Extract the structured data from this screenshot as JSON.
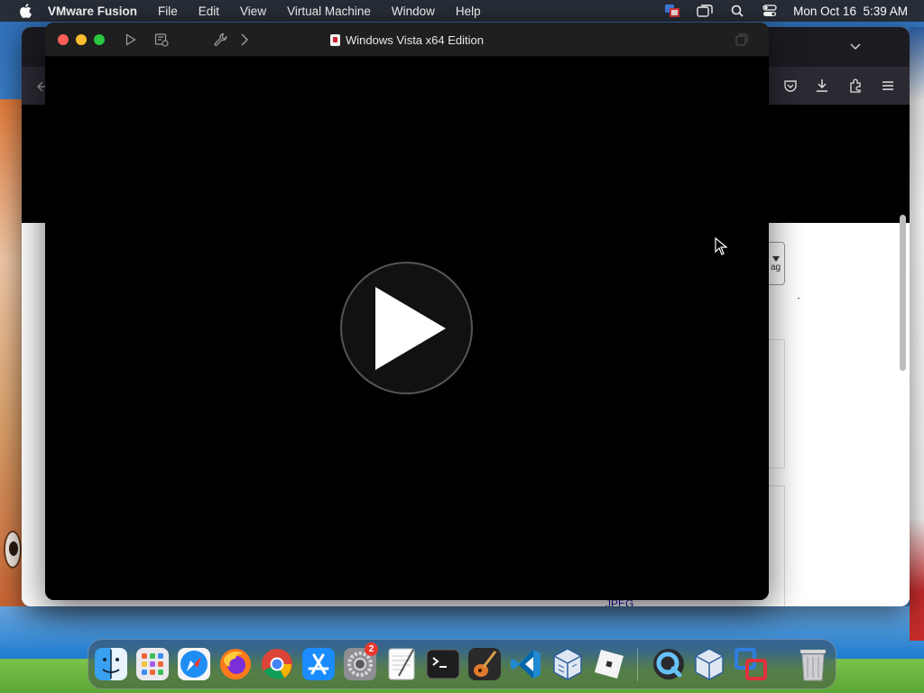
{
  "menubar": {
    "app_name": "VMware Fusion",
    "menus": [
      "File",
      "Edit",
      "View",
      "Virtual Machine",
      "Window",
      "Help"
    ],
    "status_icons": [
      "screen-share-icon",
      "window-mirror-icon",
      "search-icon",
      "control-center-icon"
    ],
    "datetime": "Mon Oct 16  5:39 AM"
  },
  "vm_window": {
    "title": "Windows Vista x64 Edition",
    "toolbar_icons": [
      "play-icon",
      "snapshot-icon",
      "settings-wrench-icon",
      "forward-chevron-icon"
    ],
    "screen_state": "powered-off",
    "play_button_icon": "play-triangle-icon"
  },
  "browser_window": {
    "toolbar_icons": [
      "back-arrow-icon",
      "pocket-icon",
      "download-icon",
      "extensions-icon",
      "menu-hamburger-icon"
    ],
    "flag_label": "ag",
    "link_text": "JPEG"
  },
  "dock": {
    "apps": [
      {
        "name": "Finder",
        "icon": "finder-icon"
      },
      {
        "name": "Launchpad",
        "icon": "launchpad-icon"
      },
      {
        "name": "Safari",
        "icon": "safari-icon"
      },
      {
        "name": "Firefox",
        "icon": "firefox-icon"
      },
      {
        "name": "Google Chrome",
        "icon": "chrome-icon"
      },
      {
        "name": "App Store",
        "icon": "app-store-icon"
      },
      {
        "name": "System Settings",
        "icon": "system-settings-icon",
        "badge": "2"
      },
      {
        "name": "TextEdit",
        "icon": "textedit-icon"
      },
      {
        "name": "Terminal",
        "icon": "terminal-icon"
      },
      {
        "name": "GarageBand",
        "icon": "garageband-icon"
      },
      {
        "name": "Visual Studio Code",
        "icon": "vscode-icon"
      },
      {
        "name": "VirtualBox",
        "icon": "virtualbox-icon"
      },
      {
        "name": "Roblox",
        "icon": "roblox-icon"
      },
      {
        "name": "QuickTime Player",
        "icon": "quicktime-icon"
      },
      {
        "name": "VirtualBox VM",
        "icon": "virtualbox-vm-icon"
      },
      {
        "name": "VMware Fusion",
        "icon": "vmware-fusion-icon"
      },
      {
        "name": "Trash",
        "icon": "trash-icon"
      }
    ]
  },
  "colors": {
    "menubar_bg": "#28282c",
    "vm_titlebar_bg": "#1f1f1f",
    "close": "#fe5f57",
    "minimize": "#febc2e",
    "maximize": "#28c840",
    "badge": "#e8392f"
  }
}
